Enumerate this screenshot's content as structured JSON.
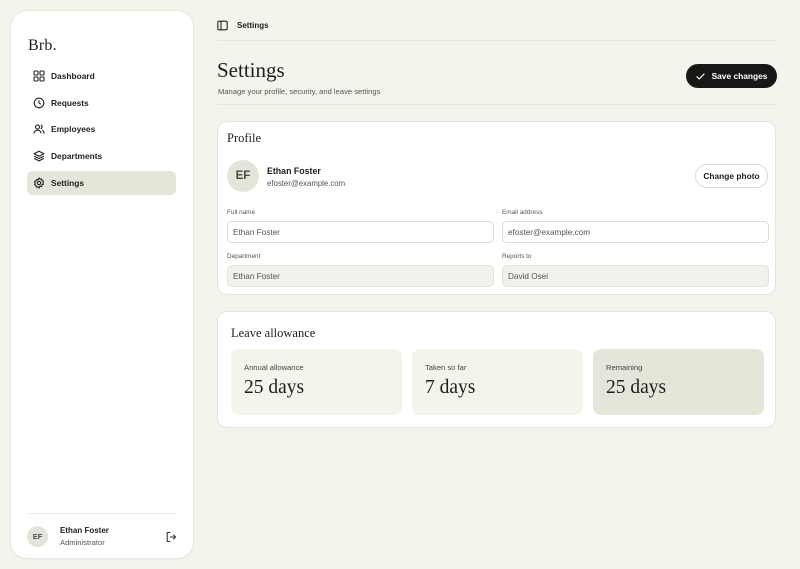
{
  "sidebar": {
    "logo": "Brb.",
    "items": [
      {
        "label": "Dashboard",
        "icon": "grid-icon"
      },
      {
        "label": "Requests",
        "icon": "clock-icon"
      },
      {
        "label": "Employees",
        "icon": "users-icon"
      },
      {
        "label": "Departments",
        "icon": "layers-icon"
      },
      {
        "label": "Settings",
        "icon": "gear-icon",
        "active": true
      }
    ],
    "user": {
      "initials": "EF",
      "name": "Ethan Foster",
      "role": "Administrator"
    }
  },
  "header": {
    "breadcrumb": "Settings"
  },
  "page": {
    "title": "Settings",
    "subtitle": "Manage your profile, security, and leave settings",
    "save_label": "Save changes"
  },
  "profile": {
    "title": "Profile",
    "initials": "EF",
    "name": "Ethan Foster",
    "email": "efoster@example.com",
    "change_photo_label": "Change photo",
    "fields": {
      "full_name": {
        "label": "Full name",
        "value": "Ethan Foster"
      },
      "email": {
        "label": "Email address",
        "value": "efoster@example.com"
      },
      "department": {
        "label": "Department",
        "value": "Ethan Foster"
      },
      "reports_to": {
        "label": "Reports to",
        "value": "David Osei"
      }
    }
  },
  "leave": {
    "title": "Leave allowance",
    "stats": [
      {
        "label": "Annual allowance",
        "value": "25 days"
      },
      {
        "label": "Taken so far",
        "value": "7 days"
      },
      {
        "label": "Remaining",
        "value": "25 days"
      }
    ]
  },
  "colors": {
    "accent": "#171715",
    "highlight": "#e4e6da",
    "background": "#f4f3ec"
  }
}
